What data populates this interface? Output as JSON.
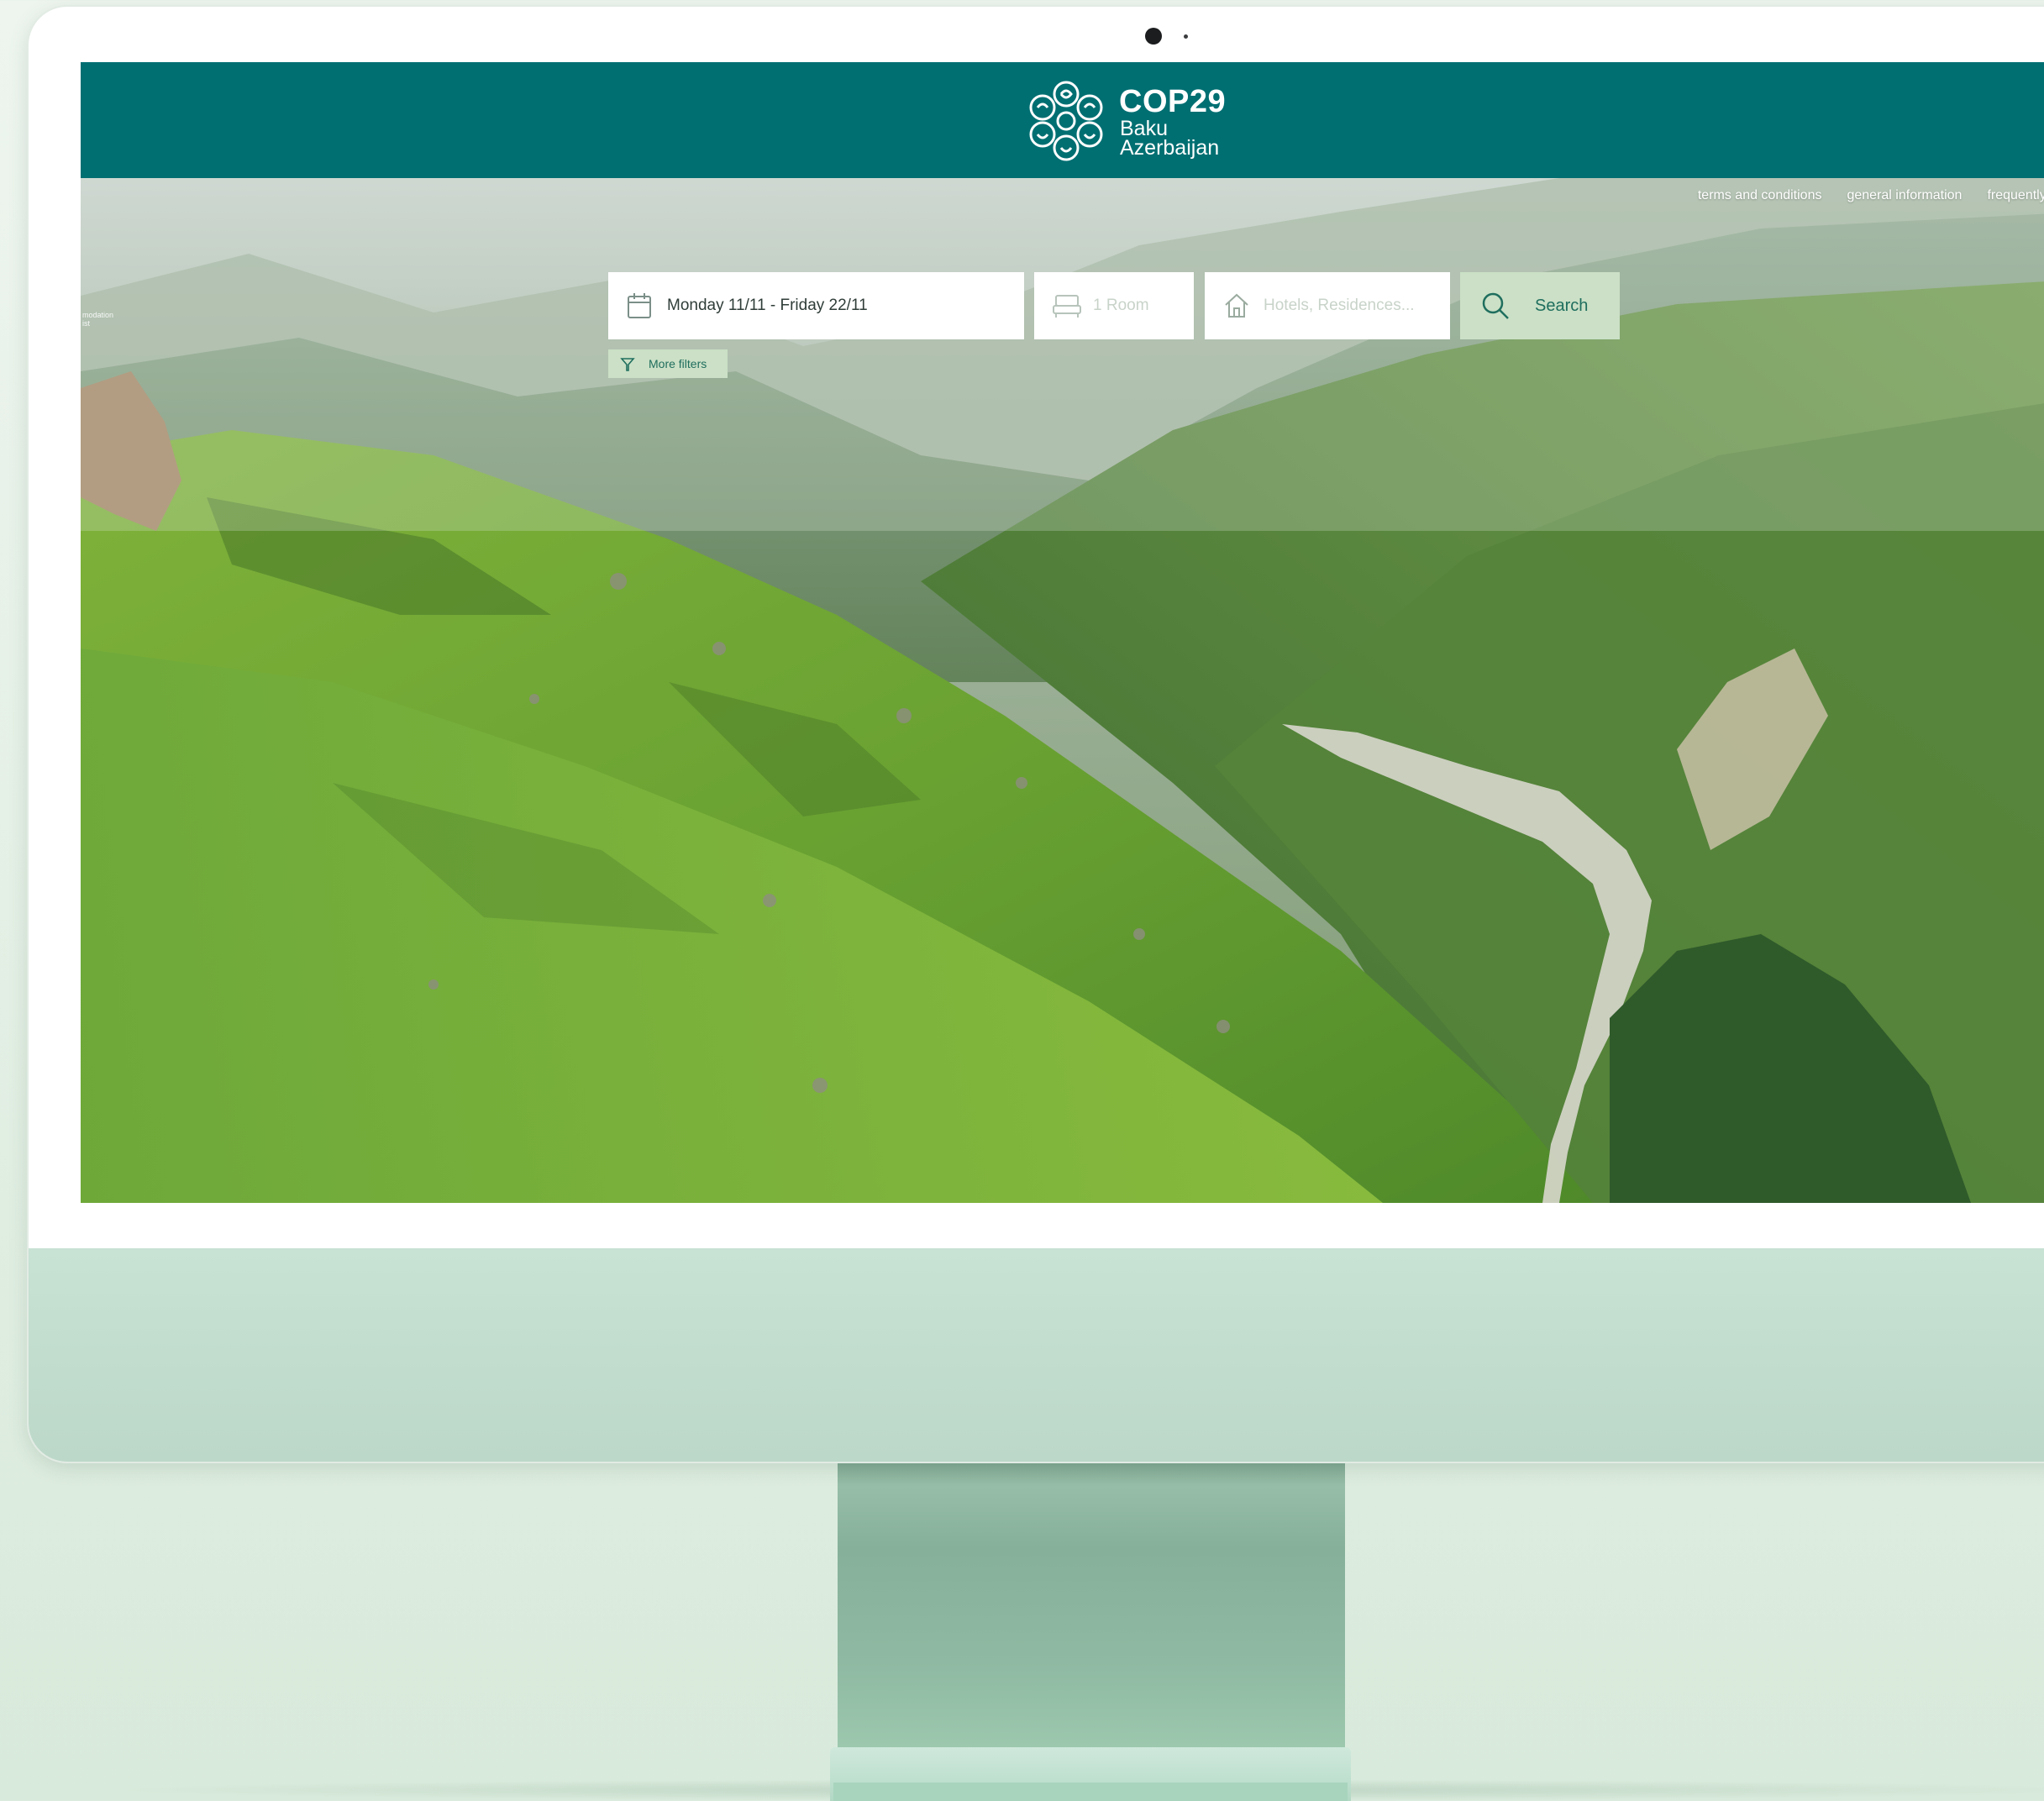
{
  "header": {
    "brand_name": "COP29",
    "brand_line1": "Baku",
    "brand_line2": "Azerbaijan"
  },
  "nav": {
    "items": [
      {
        "label": "terms and conditions"
      },
      {
        "label": "general information"
      },
      {
        "label": "frequently asked que"
      }
    ],
    "cut_label_1": "modation",
    "cut_label_2": "ist"
  },
  "search": {
    "date_value": "Monday 11/11 - Friday 22/11",
    "rooms_placeholder": "1 Room",
    "place_placeholder": "Hotels, Residences...",
    "search_label": "Search",
    "more_filters_label": "More filters"
  },
  "icons": {
    "calendar": "calendar-icon",
    "bed": "bed-icon",
    "house": "house-icon",
    "search": "search-icon",
    "filter": "filter-icon",
    "logo": "cop29-logo-icon"
  },
  "colors": {
    "header_teal": "#006f72",
    "button_green": "#cbe0c6",
    "button_text": "#1f6e5e",
    "monitor_body": "#c8e2d4"
  }
}
